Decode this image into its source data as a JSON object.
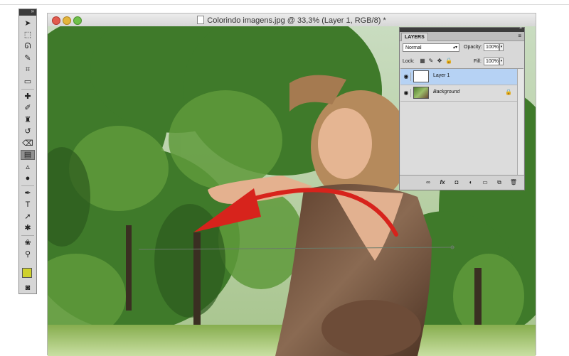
{
  "window": {
    "title": "Colorindo imagens.jpg @ 33,3% (Layer 1, RGB/8) *"
  },
  "toolbox": {
    "tools": [
      {
        "name": "move-tool",
        "glyph": "➤"
      },
      {
        "name": "marquee-tool",
        "glyph": "⬚"
      },
      {
        "name": "lasso-tool",
        "glyph": "ᘏ"
      },
      {
        "name": "quick-selection-tool",
        "glyph": "✎"
      },
      {
        "name": "crop-tool",
        "glyph": "⌗"
      },
      {
        "name": "ruler-tool",
        "glyph": "▭"
      },
      {
        "name": "healing-brush-tool",
        "glyph": "✚"
      },
      {
        "name": "brush-tool",
        "glyph": "✐"
      },
      {
        "name": "clone-stamp-tool",
        "glyph": "♜"
      },
      {
        "name": "history-brush-tool",
        "glyph": "↺"
      },
      {
        "name": "eraser-tool",
        "glyph": "⌫"
      },
      {
        "name": "gradient-tool",
        "glyph": "▤"
      },
      {
        "name": "blur-tool",
        "glyph": "▵"
      },
      {
        "name": "dodge-tool",
        "glyph": "●"
      },
      {
        "name": "pen-tool",
        "glyph": "✒"
      },
      {
        "name": "type-tool",
        "glyph": "T"
      },
      {
        "name": "path-selection-tool",
        "glyph": "➚"
      },
      {
        "name": "custom-shape-tool",
        "glyph": "✱"
      },
      {
        "name": "3d-rotate-tool",
        "glyph": "❀"
      },
      {
        "name": "zoom-tool",
        "glyph": "⚲"
      }
    ],
    "selected_tool": "gradient-tool",
    "foreground_color": "#cfd12c",
    "background_color": "#6e6e6e"
  },
  "layers_panel": {
    "tab_label": "LAYERS",
    "blend_mode": "Normal",
    "opacity_label": "Opacity:",
    "opacity_value": "100%",
    "lock_label": "Lock:",
    "fill_label": "Fill:",
    "fill_value": "100%",
    "layers": [
      {
        "name": "Layer 1",
        "active": true,
        "italic": false,
        "locked": false,
        "thumb": "blank"
      },
      {
        "name": "Background",
        "active": false,
        "italic": true,
        "locked": true,
        "thumb": "photo"
      }
    ],
    "footer_icons": [
      "link-icon",
      "fx-icon",
      "mask-icon",
      "adjustment-icon",
      "group-icon",
      "new-layer-icon",
      "trash-icon"
    ]
  }
}
